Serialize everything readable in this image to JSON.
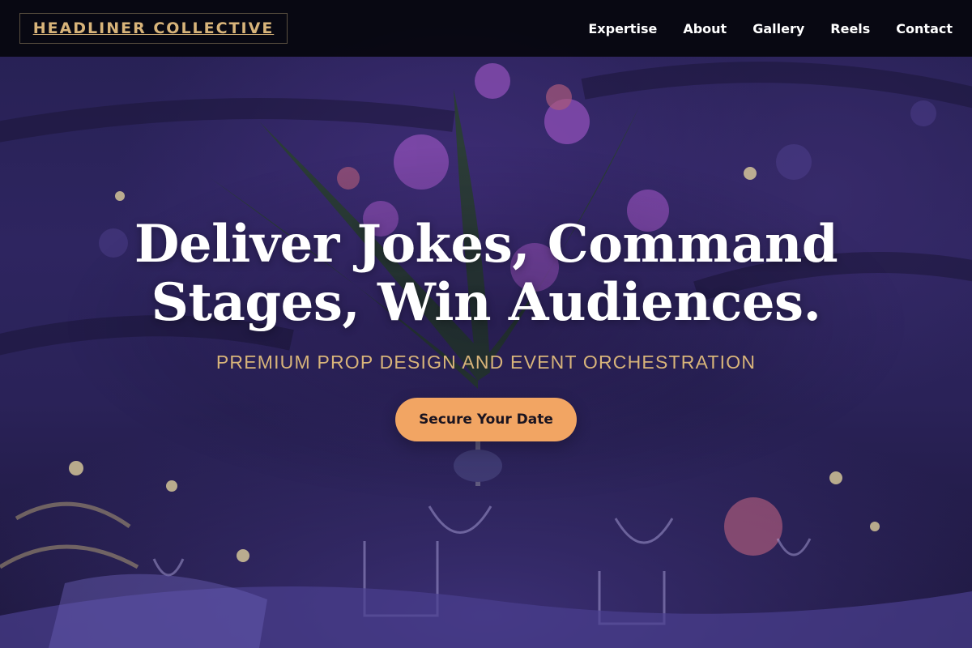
{
  "header": {
    "brand": "HEADLINER COLLECTIVE",
    "nav": [
      "Expertise",
      "About",
      "Gallery",
      "Reels",
      "Contact"
    ]
  },
  "hero": {
    "headline_line1": "Deliver Jokes, Command",
    "headline_line2": "Stages, Win Audiences.",
    "subheadline": "PREMIUM PROP DESIGN AND EVENT ORCHESTRATION",
    "cta_label": "Secure Your Date"
  },
  "colors": {
    "accent_gold": "#d8b47a",
    "cta_orange": "#f2a563",
    "header_bg": "#06060e",
    "hero_purple": "#2e2560"
  }
}
